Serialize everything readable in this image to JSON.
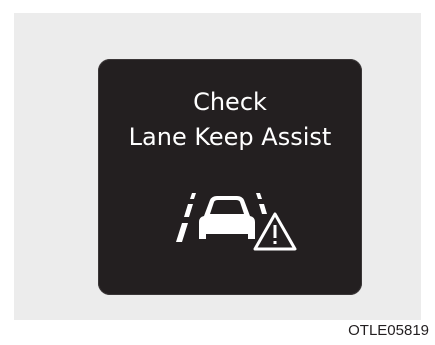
{
  "message": {
    "line1": "Check",
    "line2": "Lane Keep Assist"
  },
  "icon": "lane-keep-assist-warning-icon",
  "figure_code": "OTLE05819",
  "colors": {
    "display_bg": "#231f20",
    "text": "#ffffff",
    "panel_bg": "#ececec"
  }
}
